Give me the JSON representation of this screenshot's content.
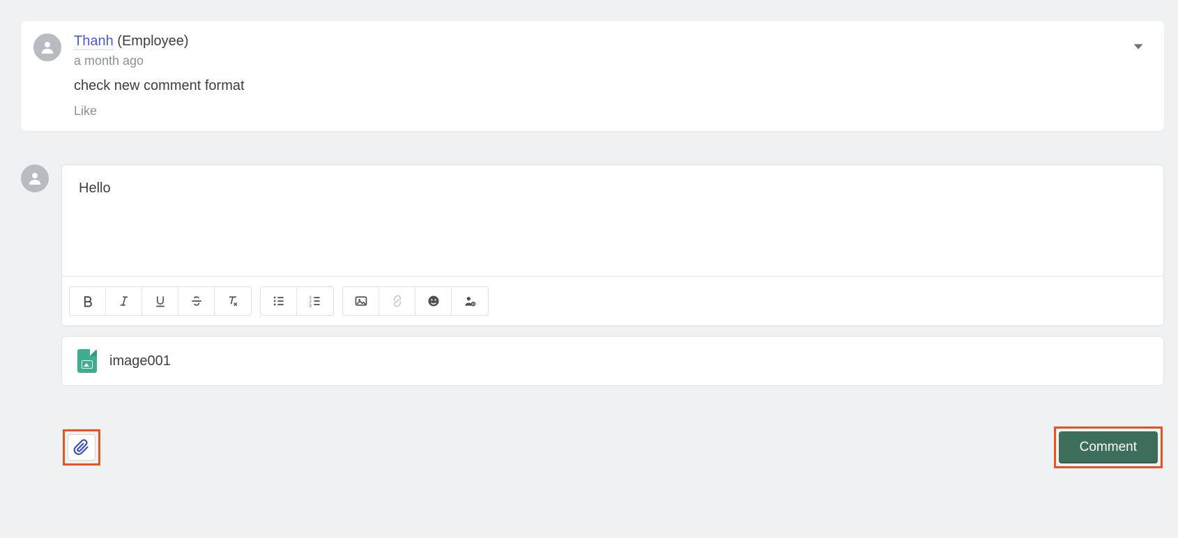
{
  "comment": {
    "author_name": "Thanh",
    "author_role": "(Employee)",
    "timestamp": "a month ago",
    "body": "check new comment format",
    "like_label": "Like"
  },
  "composer": {
    "content": "Hello"
  },
  "attachment": {
    "name": "image001"
  },
  "actions": {
    "submit_label": "Comment"
  }
}
